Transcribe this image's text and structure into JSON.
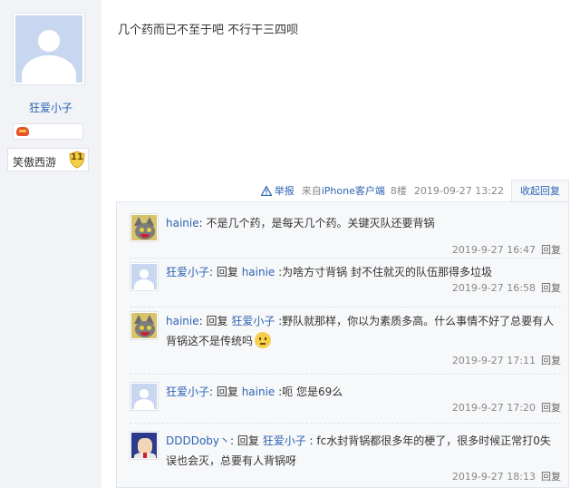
{
  "author": {
    "username": "狂爱小子",
    "level_title": "笑傲西游",
    "level_num": "11",
    "avatar_icon": "default-avatar-icon",
    "badge_icon": "game-controller-icon"
  },
  "post": {
    "content": "几个药而已不至于吧 不行干三四呗"
  },
  "meta": {
    "report_label": "举报",
    "from_prefix": "来自",
    "from_client": "iPhone客户端",
    "floor": "8楼",
    "datetime": "2019-09-27 13:22",
    "collapse_label": "收起回复"
  },
  "replies": [
    {
      "avatar": "cat-avatar-icon",
      "user": "hainie",
      "reply_word": "",
      "target": "",
      "text": ": 不是几个药，是每天几个药。关键灭队还要背锅",
      "time": "2019-9-27 16:47",
      "reply_label": "回复"
    },
    {
      "avatar": "default-avatar-icon",
      "user": "狂爱小子",
      "reply_word": ": 回复 ",
      "target": "hainie",
      "text": " :为啥方寸背锅 封不住就灭的队伍那得多垃圾",
      "time": "2019-9-27 16:58",
      "reply_label": "回复"
    },
    {
      "avatar": "cat-avatar-icon",
      "user": "hainie",
      "reply_word": ": 回复 ",
      "target": "狂爱小子",
      "text": " :野队就那样，你以为素质多高。什么事情不好了总要有人背锅这不是传统吗",
      "time": "2019-9-27 17:11",
      "reply_label": "回复",
      "emoji": "confused-emoji-icon"
    },
    {
      "avatar": "default-avatar-icon",
      "user": "狂爱小子",
      "reply_word": ": 回复 ",
      "target": "hainie",
      "text": " :呃 您是69么",
      "time": "2019-9-27 17:20",
      "reply_label": "回复"
    },
    {
      "avatar": "businessman-avatar-icon",
      "user": "DDDDoby丶",
      "reply_word": ": 回复 ",
      "target": "狂爱小子",
      "text": " : fc水封背锅都很多年的梗了，很多时候正常打0失误也会灭，总要有人背锅呀",
      "time": "2019-9-27 18:13",
      "reply_label": "回复"
    }
  ],
  "colors": {
    "link": "#2d64b3",
    "sidebar_bg": "#f1f3f6",
    "reply_bg": "#f7f8fa"
  }
}
